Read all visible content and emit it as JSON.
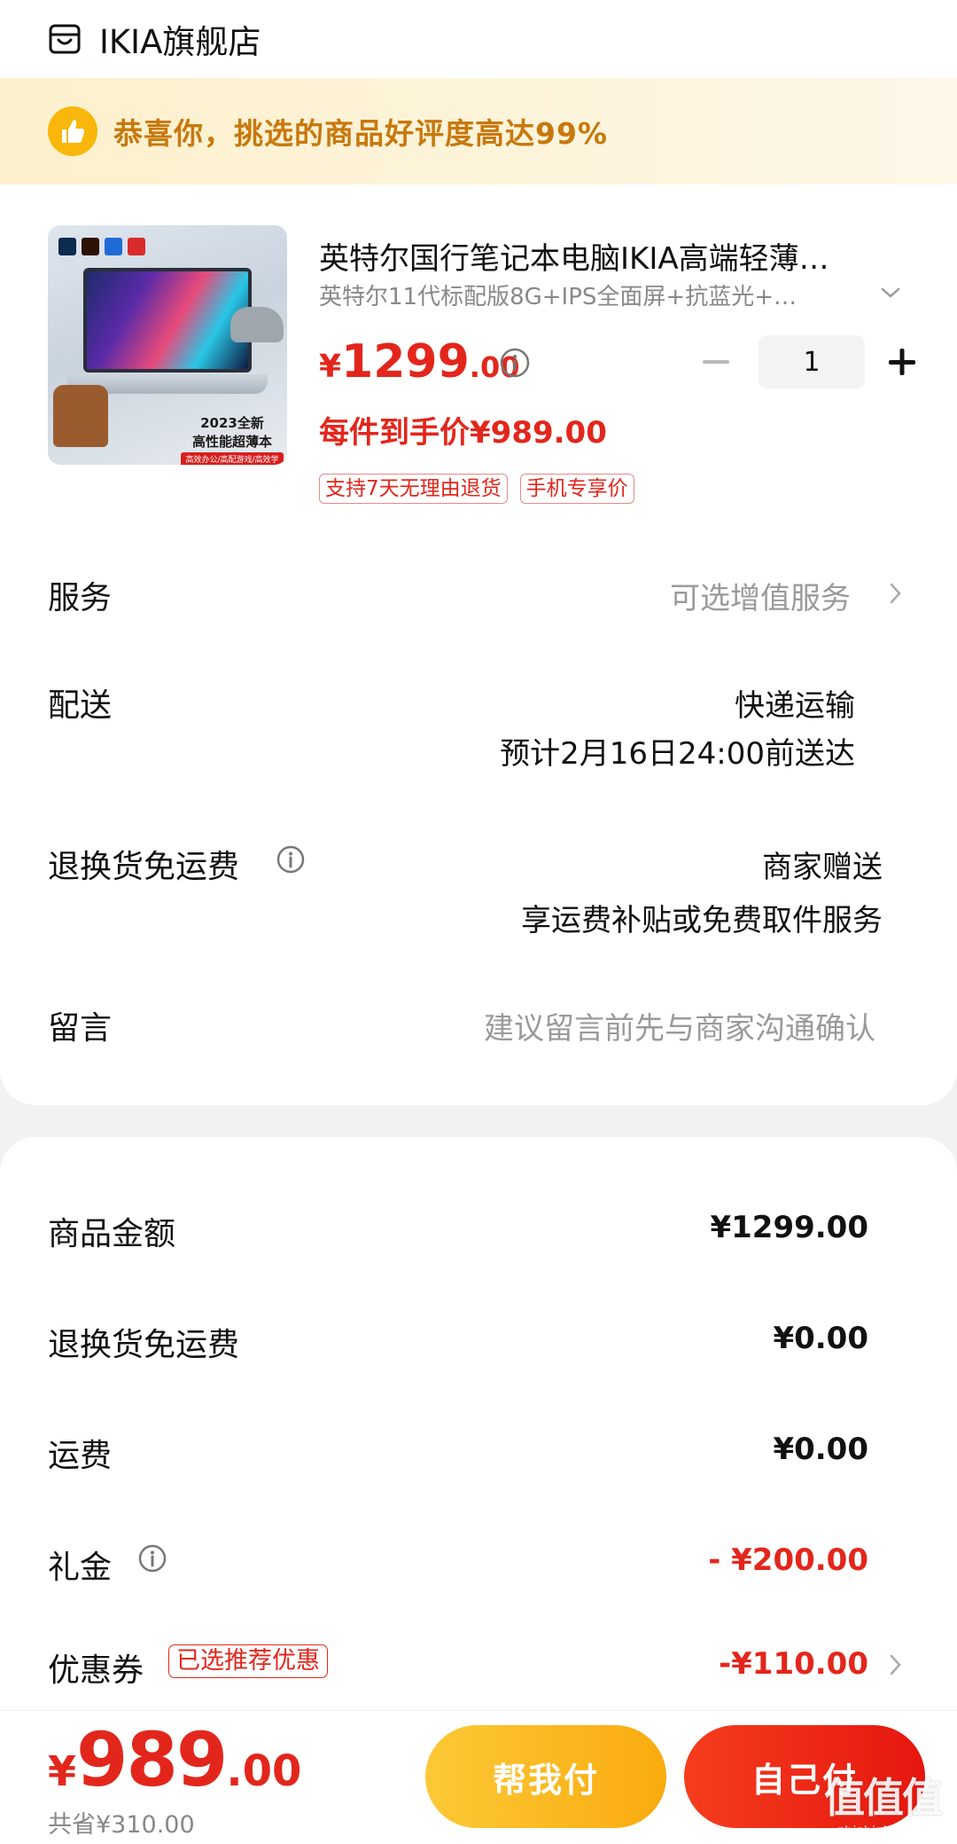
{
  "store": {
    "name": "IKIA旗舰店",
    "icon": "store-icon"
  },
  "praise": {
    "text": "恭喜你，挑选的商品好评度高达99%",
    "icon": "thumbs-up-icon"
  },
  "product": {
    "thumb_caption": [
      "2023全新",
      "高性能超薄本",
      "高效办公/高配游戏/高效学习"
    ],
    "title": "英特尔国行笔记本电脑IKIA高端轻薄…",
    "spec": "英特尔11代标配版8G+IPS全面屏+抗蓝光+…",
    "price_symbol": "¥",
    "price_int": "1299",
    "price_dec": ".00",
    "quantity": "1",
    "per_piece_price": "每件到手价¥989.00",
    "tags": [
      "支持7天无理由退货",
      "手机专享价"
    ]
  },
  "rows": {
    "service": {
      "label": "服务",
      "value": "可选增值服务"
    },
    "delivery": {
      "label": "配送",
      "value": "快递运输",
      "eta": "预计2月16日24:00前送达"
    },
    "return_shipping": {
      "label": "退换货免运费",
      "value": "商家赠送",
      "detail": "享运费补贴或免费取件服务"
    },
    "message": {
      "label": "留言",
      "placeholder": "建议留言前先与商家沟通确认"
    }
  },
  "summary": {
    "goods_amount": {
      "label": "商品金额",
      "value": "¥1299.00"
    },
    "return_shipping_fee": {
      "label": "退换货免运费",
      "value": "¥0.00"
    },
    "shipping_fee": {
      "label": "运费",
      "value": "¥0.00"
    },
    "gift_money": {
      "label": "礼金",
      "value": "- ¥200.00"
    },
    "coupon": {
      "label": "优惠券",
      "tag": "已选推荐优惠",
      "value": "-¥110.00"
    }
  },
  "bottom": {
    "total_symbol": "¥",
    "total_int": "989",
    "total_dec": ".00",
    "saved": "共省¥310.00",
    "help_pay_label": "帮我付",
    "self_pay_label": "自己付",
    "watermark": "值值值",
    "watermark_sub": "zhizhizhi.com"
  },
  "colors": {
    "accent_red": "#e3261c",
    "banner_text": "#c8780c",
    "help_pay_yellow": "#f9ab0f"
  }
}
